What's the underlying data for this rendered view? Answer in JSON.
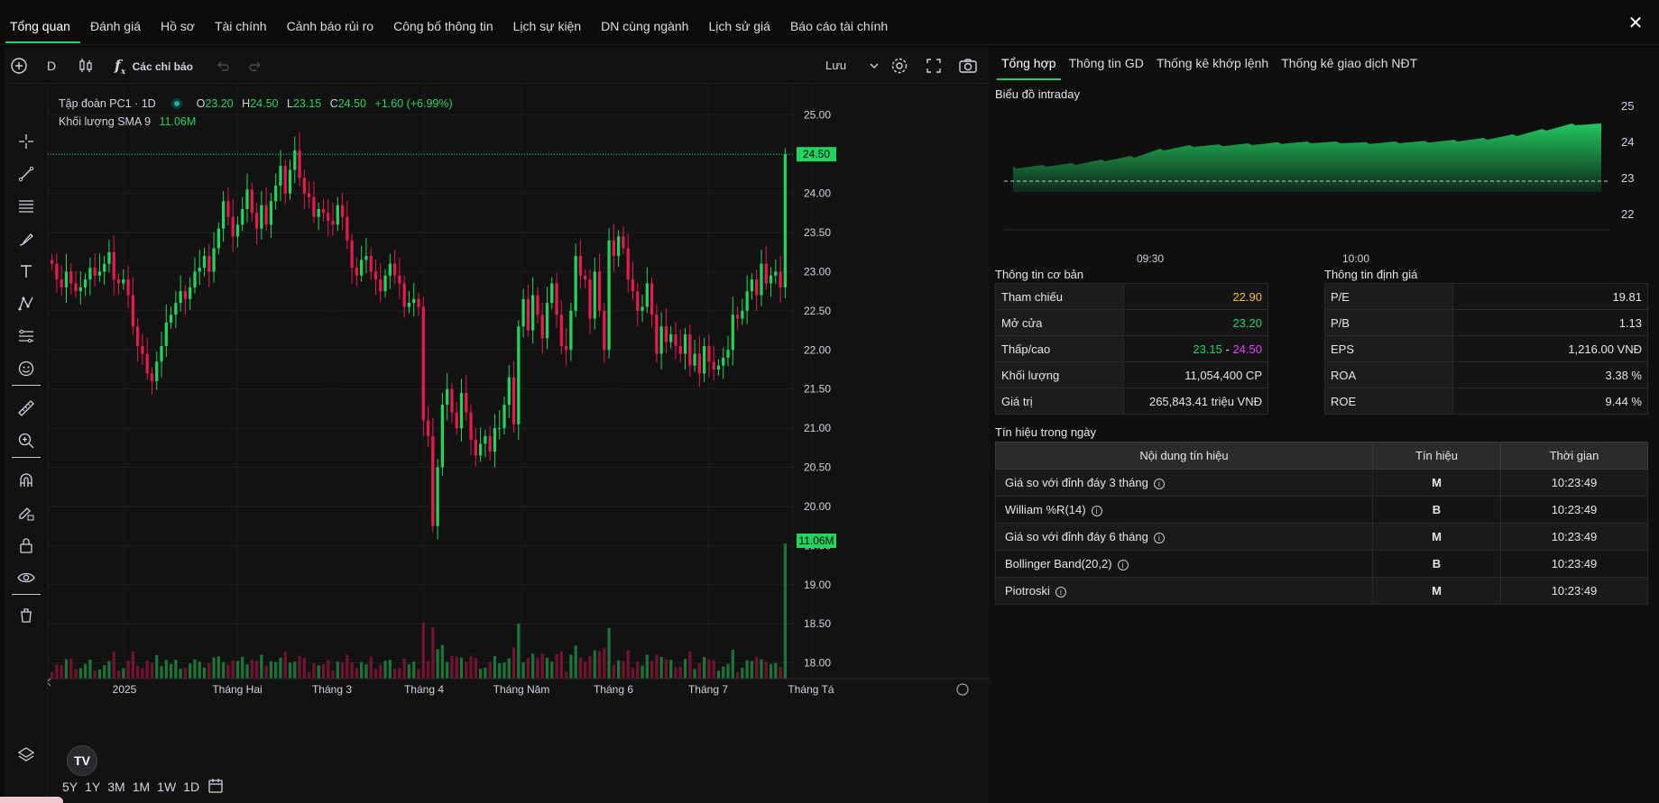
{
  "nav": {
    "tabs": [
      "Tổng quan",
      "Đánh giá",
      "Hồ sơ",
      "Tài chính",
      "Cảnh báo rủi ro",
      "Công bố thông tin",
      "Lịch sự kiện",
      "DN cùng ngành",
      "Lịch sử giá",
      "Báo cáo tài chính"
    ],
    "close": "✕"
  },
  "toolbar": {
    "interval": "D",
    "indicators": "Các chỉ báo",
    "save": "Lưu",
    "fx": "f",
    "fx_sub": "x"
  },
  "legend": {
    "symbol": "Tập đoàn PC1 · 1D",
    "o_label": "O",
    "o": "23.20",
    "h_label": "H",
    "h": "24.50",
    "l_label": "L",
    "l": "23.15",
    "c_label": "C",
    "c": "24.50",
    "change": "+1.60 (+6.99%)",
    "volume_label": "Khối lượng SMA 9",
    "volume": "11.06M"
  },
  "ranges": [
    "5Y",
    "1Y",
    "3M",
    "1M",
    "1W",
    "1D"
  ],
  "tv_logo": "TV",
  "chart_data": {
    "type": "candlestick",
    "y_ticks": [
      "25.00",
      "24.50",
      "24.00",
      "23.50",
      "23.00",
      "22.50",
      "22.00",
      "21.50",
      "21.00",
      "20.50",
      "20.00",
      "19.50",
      "19.00",
      "18.50",
      "18.00"
    ],
    "ylim": [
      17.8,
      25.4
    ],
    "x_ticks": [
      "2025",
      "Tháng Hai",
      "Tháng 3",
      "Tháng 4",
      "Tháng Năm",
      "Tháng 6",
      "Tháng 7",
      "Tháng Tá"
    ],
    "last_price_label": "24.50",
    "last_price": 24.5,
    "volume_label": "11.06M",
    "up_color": "#22d35e",
    "down_color": "#e8194f",
    "closes": [
      23.1,
      22.9,
      22.8,
      23.0,
      22.85,
      22.75,
      22.8,
      22.9,
      23.05,
      22.95,
      23.0,
      23.1,
      23.25,
      22.9,
      22.85,
      22.9,
      22.7,
      22.3,
      22.05,
      21.95,
      21.7,
      21.6,
      21.85,
      22.05,
      22.35,
      22.45,
      22.6,
      22.75,
      22.65,
      22.8,
      23.0,
      23.05,
      23.2,
      23.0,
      23.3,
      23.55,
      23.9,
      23.7,
      23.45,
      23.6,
      23.8,
      24.05,
      23.75,
      23.55,
      23.85,
      23.6,
      23.9,
      24.1,
      24.35,
      24.0,
      24.3,
      24.55,
      24.2,
      24.0,
      23.95,
      23.7,
      23.8,
      23.75,
      23.65,
      23.6,
      23.85,
      23.7,
      23.4,
      23.05,
      22.95,
      23.15,
      23.2,
      23.0,
      22.9,
      22.75,
      22.95,
      23.1,
      22.95,
      22.85,
      22.55,
      22.6,
      22.65,
      22.55,
      21.1,
      20.9,
      19.75,
      20.5,
      21.3,
      21.5,
      21.2,
      21.0,
      21.45,
      21.2,
      20.85,
      20.65,
      20.8,
      20.9,
      20.7,
      21.0,
      21.0,
      21.3,
      21.65,
      21.05,
      22.3,
      22.65,
      22.25,
      22.7,
      22.45,
      22.15,
      22.6,
      22.85,
      22.45,
      22.05,
      22.0,
      22.5,
      23.2,
      22.95,
      22.9,
      22.4,
      23.0,
      22.5,
      22.0,
      23.4,
      23.2,
      23.45,
      23.3,
      22.9,
      22.75,
      22.5,
      22.55,
      22.85,
      22.45,
      21.95,
      22.3,
      22.1,
      22.2,
      22.05,
      21.95,
      22.2,
      21.8,
      21.95,
      21.7,
      22.05,
      21.85,
      21.75,
      21.8,
      21.9,
      22.0,
      22.45,
      22.4,
      22.5,
      22.75,
      22.9,
      22.7,
      23.1,
      22.85,
      22.95,
      23.0,
      22.8,
      24.5
    ]
  },
  "right_tabs": [
    "Tổng hợp",
    "Thông tin GD",
    "Thống kê khớp lệnh",
    "Thống kê giao dịch NĐT"
  ],
  "intraday": {
    "title": "Biểu đồ intraday",
    "y_ticks": [
      "25",
      "24",
      "23",
      "22"
    ],
    "x_ticks": [
      "09:30",
      "10:00"
    ],
    "ylim": [
      22,
      25
    ],
    "reference": 22.9,
    "values": [
      23.3,
      23.35,
      23.4,
      23.5,
      23.6,
      23.8,
      23.9,
      23.92,
      23.95,
      23.98,
      24.0,
      24.0,
      23.98,
      24.0,
      24.02,
      24.05,
      24.1,
      24.2,
      24.35,
      24.5,
      24.5
    ]
  },
  "basic_info": {
    "title": "Thông tin cơ bản",
    "rows": [
      {
        "label": "Tham chiếu",
        "value": "22.90"
      },
      {
        "label": "Mở cửa",
        "value": "23.20"
      },
      {
        "label": "Thấp/cao",
        "low": "23.15",
        "sep": " - ",
        "high": "24.50"
      },
      {
        "label": "Khối lượng",
        "value": "11,054,400 CP"
      },
      {
        "label": "Giá trị",
        "value": "265,843.41 triệu VNĐ"
      }
    ]
  },
  "valuation": {
    "title": "Thông tin định giá",
    "rows": [
      {
        "label": "P/E",
        "value": "19.81"
      },
      {
        "label": "P/B",
        "value": "1.13"
      },
      {
        "label": "EPS",
        "value": "1,216.00 VNĐ"
      },
      {
        "label": "ROA",
        "value": "3.38 %"
      },
      {
        "label": "ROE",
        "value": "9.44 %"
      }
    ]
  },
  "signals": {
    "title": "Tín hiệu trong ngày",
    "headers": [
      "Nội dung tín hiệu",
      "Tín hiệu",
      "Thời gian"
    ],
    "rows": [
      {
        "name": "Giá so với đỉnh đáy 3 tháng",
        "signal": "M",
        "time": "10:23:49"
      },
      {
        "name": "William %R(14)",
        "signal": "B",
        "time": "10:23:49"
      },
      {
        "name": "Giá so với đỉnh đáy 6 tháng",
        "signal": "M",
        "time": "10:23:49"
      },
      {
        "name": "Bollinger Band(20,2)",
        "signal": "B",
        "time": "10:23:49"
      },
      {
        "name": "Piotroski",
        "signal": "M",
        "time": "10:23:49"
      }
    ],
    "info_glyph": "i"
  },
  "colors": {
    "accent": "#1fd36b",
    "yellow": "#f5c518",
    "magenta": "#e040fb"
  }
}
